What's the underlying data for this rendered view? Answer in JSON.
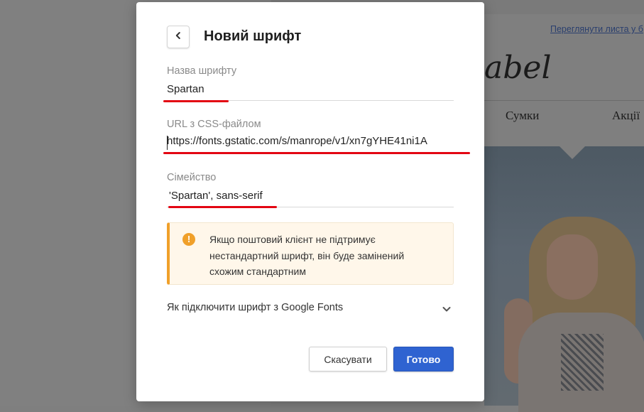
{
  "background": {
    "preview_link": "Переглянути листа у б",
    "logo_text": "abel",
    "nav_items": [
      "Сумки",
      "Акції"
    ]
  },
  "modal": {
    "title": "Новий шрифт",
    "back_icon": "chevron-left-icon",
    "font_name": {
      "label": "Назва шрифту",
      "value": "Spartan"
    },
    "css_url": {
      "label": "URL з CSS-файлом",
      "value": "https://fonts.gstatic.com/s/manrope/v1/xn7gYHE41ni1A"
    },
    "family": {
      "label": "Сімейство",
      "value": "'Spartan', sans-serif"
    },
    "notice": {
      "icon": "exclamation-circle-icon",
      "text": "Якщо поштовий клієнт не підтримує нестандартний шрифт, він буде замінений схожим стандартним"
    },
    "google_fonts_link": "Як підключити шрифт з Google Fonts",
    "cancel_label": "Скасувати",
    "ok_label": "Готово"
  },
  "colors": {
    "accent": "#2f63d1",
    "warning": "#f0a02a",
    "annotation_red": "#e30613"
  }
}
